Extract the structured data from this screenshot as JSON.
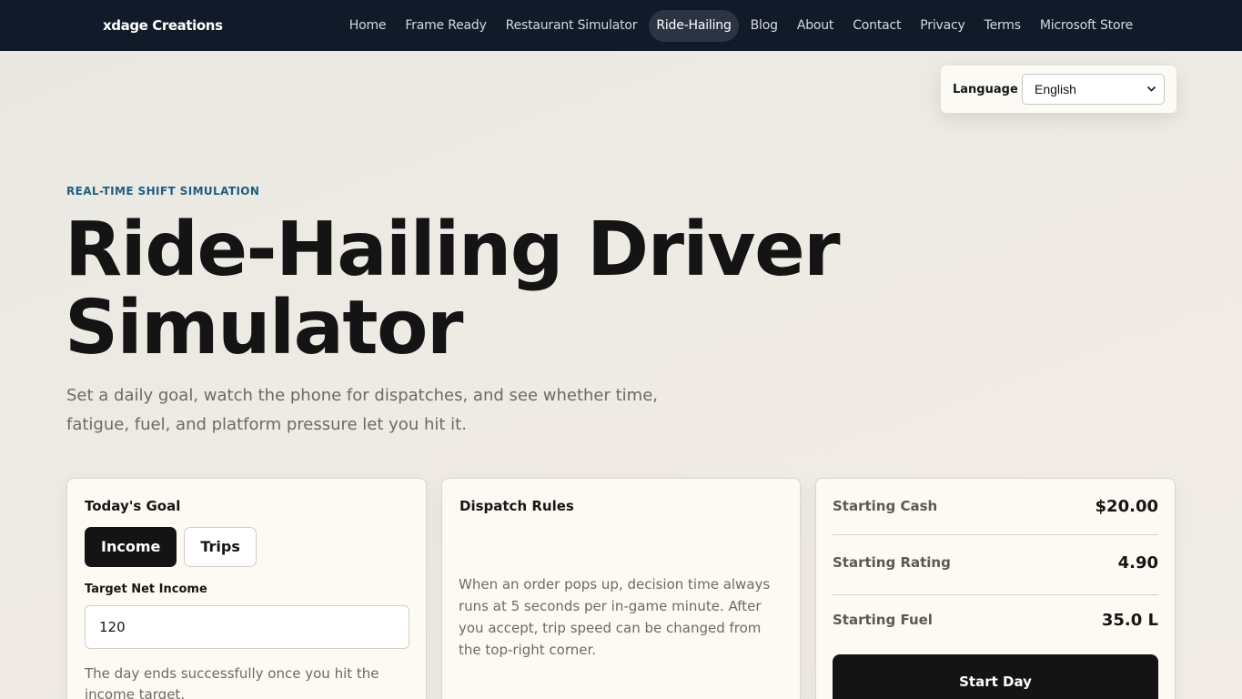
{
  "header": {
    "brand": "xdage Creations",
    "nav": [
      {
        "label": "Home",
        "active": false
      },
      {
        "label": "Frame Ready",
        "active": false
      },
      {
        "label": "Restaurant Simulator",
        "active": false
      },
      {
        "label": "Ride-Hailing",
        "active": true
      },
      {
        "label": "Blog",
        "active": false
      },
      {
        "label": "About",
        "active": false
      },
      {
        "label": "Contact",
        "active": false
      },
      {
        "label": "Privacy",
        "active": false
      },
      {
        "label": "Terms",
        "active": false
      },
      {
        "label": "Microsoft Store",
        "active": false
      }
    ]
  },
  "language": {
    "label": "Language",
    "selected": "English"
  },
  "hero": {
    "kicker": "REAL-TIME SHIFT SIMULATION",
    "title_line1": "Ride-Hailing Driver",
    "title_line2": "Simulator",
    "subtitle": "Set a daily goal, watch the phone for dispatches, and see whether time, fatigue, fuel, and platform pressure let you hit it."
  },
  "goal_card": {
    "title": "Today's Goal",
    "modes": [
      "Income",
      "Trips"
    ],
    "selected_mode": "Income",
    "target_label": "Target Net Income",
    "target_value": "120",
    "note": "The day ends successfully once you hit the income target."
  },
  "rules_card": {
    "title": "Dispatch Rules",
    "text": "When an order pops up, decision time always runs at 5 seconds per in-game minute. After you accept, trip speed can be changed from the top-right corner."
  },
  "start_card": {
    "stats": [
      {
        "label": "Starting Cash",
        "value": "$20.00"
      },
      {
        "label": "Starting Rating",
        "value": "4.90"
      },
      {
        "label": "Starting Fuel",
        "value": "35.0 L"
      }
    ],
    "start_button": "Start Day"
  },
  "colors": {
    "topbar": "#111a28",
    "accent_kicker": "#1f5d82",
    "primary_button": "#141414"
  }
}
